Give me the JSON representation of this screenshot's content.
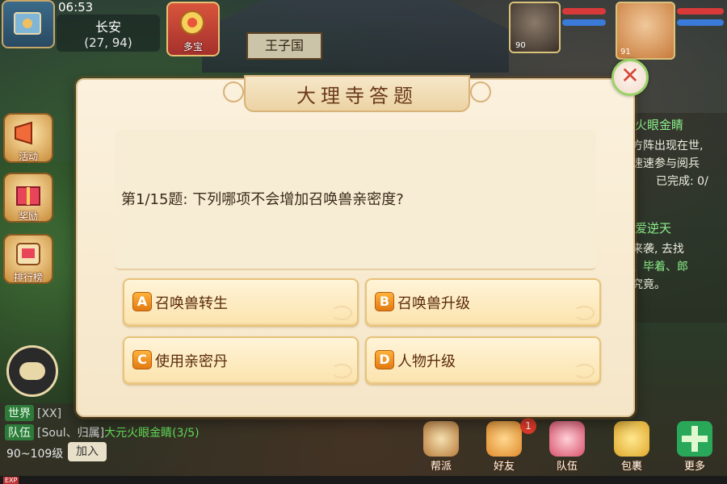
{
  "hud": {
    "time": "06:53",
    "city": "长安",
    "coords": "(27, 94)",
    "treasure_label": "多宝",
    "building_sign": "王子国"
  },
  "side_buttons": [
    {
      "label": "活动"
    },
    {
      "label": "奖励"
    },
    {
      "label": "排行榜"
    }
  ],
  "portraits": {
    "pet_level": "90",
    "hero_level": "91"
  },
  "tasks": {
    "task1_title": "火眼金睛",
    "task1_lines": [
      "方阵出现在世,",
      "速速参与阅兵",
      "已完成: 0/"
    ],
    "task2_title": "爱逆天",
    "task2_lines": [
      "来袭, 去找",
      "、毕着、郎",
      "究竟。"
    ]
  },
  "chat": {
    "world_channel": "世界",
    "world_text": "[XX]",
    "team_channel": "队伍",
    "team_text": "[Soul、归属]",
    "team_highlight": "大元火眼金睛(3/5)",
    "level_range": "90~109级",
    "join_label": "加入",
    "exp_label": "EXP"
  },
  "bottom_buttons": [
    {
      "label": "帮派"
    },
    {
      "label": "好友"
    },
    {
      "label": "队伍"
    },
    {
      "label": "包裹"
    },
    {
      "label": "更多"
    }
  ],
  "friend_badge": "1",
  "quiz": {
    "title": "大理寺答题",
    "question": "第1/15题: 下列哪项不会增加召唤兽亲密度?",
    "options": [
      {
        "letter": "A",
        "text": "召唤兽转生"
      },
      {
        "letter": "B",
        "text": "召唤兽升级"
      },
      {
        "letter": "C",
        "text": "使用亲密丹"
      },
      {
        "letter": "D",
        "text": "人物升级"
      }
    ],
    "close_symbol": "✕"
  }
}
